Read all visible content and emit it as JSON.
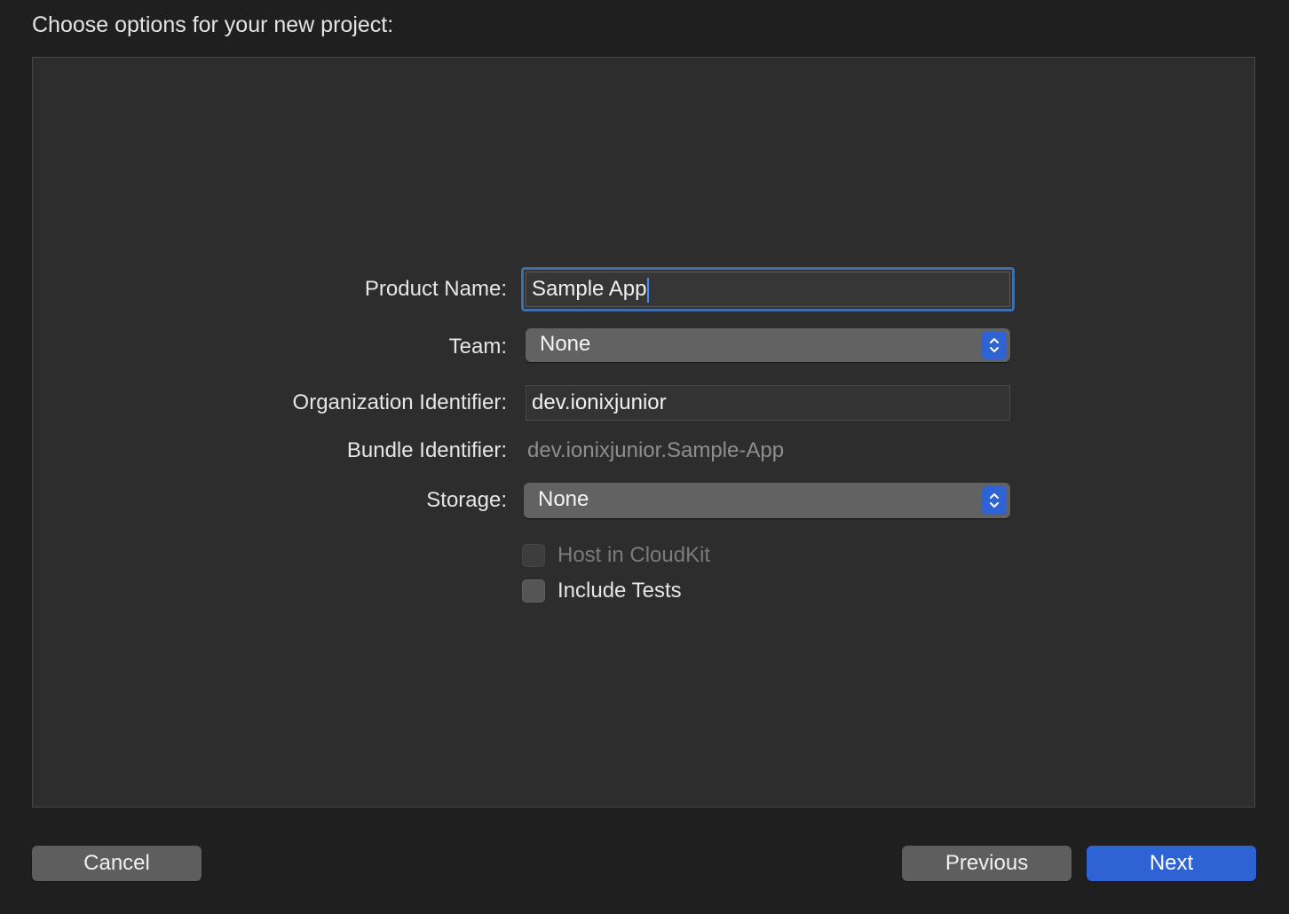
{
  "heading": "Choose options for your new project:",
  "form": {
    "product_name": {
      "label": "Product Name:",
      "value": "Sample App"
    },
    "team": {
      "label": "Team:",
      "value": "None"
    },
    "organization_identifier": {
      "label": "Organization Identifier:",
      "value": "dev.ionixjunior"
    },
    "bundle_identifier": {
      "label": "Bundle Identifier:",
      "value": "dev.ionixjunior.Sample-App"
    },
    "storage": {
      "label": "Storage:",
      "value": "None"
    },
    "host_in_cloudkit": {
      "label": "Host in CloudKit",
      "checked": false,
      "enabled": false
    },
    "include_tests": {
      "label": "Include Tests",
      "checked": false,
      "enabled": true
    }
  },
  "buttons": {
    "cancel": "Cancel",
    "previous": "Previous",
    "next": "Next"
  },
  "colors": {
    "accent": "#2f63d4",
    "focus_ring": "#3f6ea8",
    "panel_bg": "#2d2d2d",
    "window_bg": "#1f1f1f"
  },
  "icons": {
    "popup_indicator": "chevron-up-down-icon"
  }
}
